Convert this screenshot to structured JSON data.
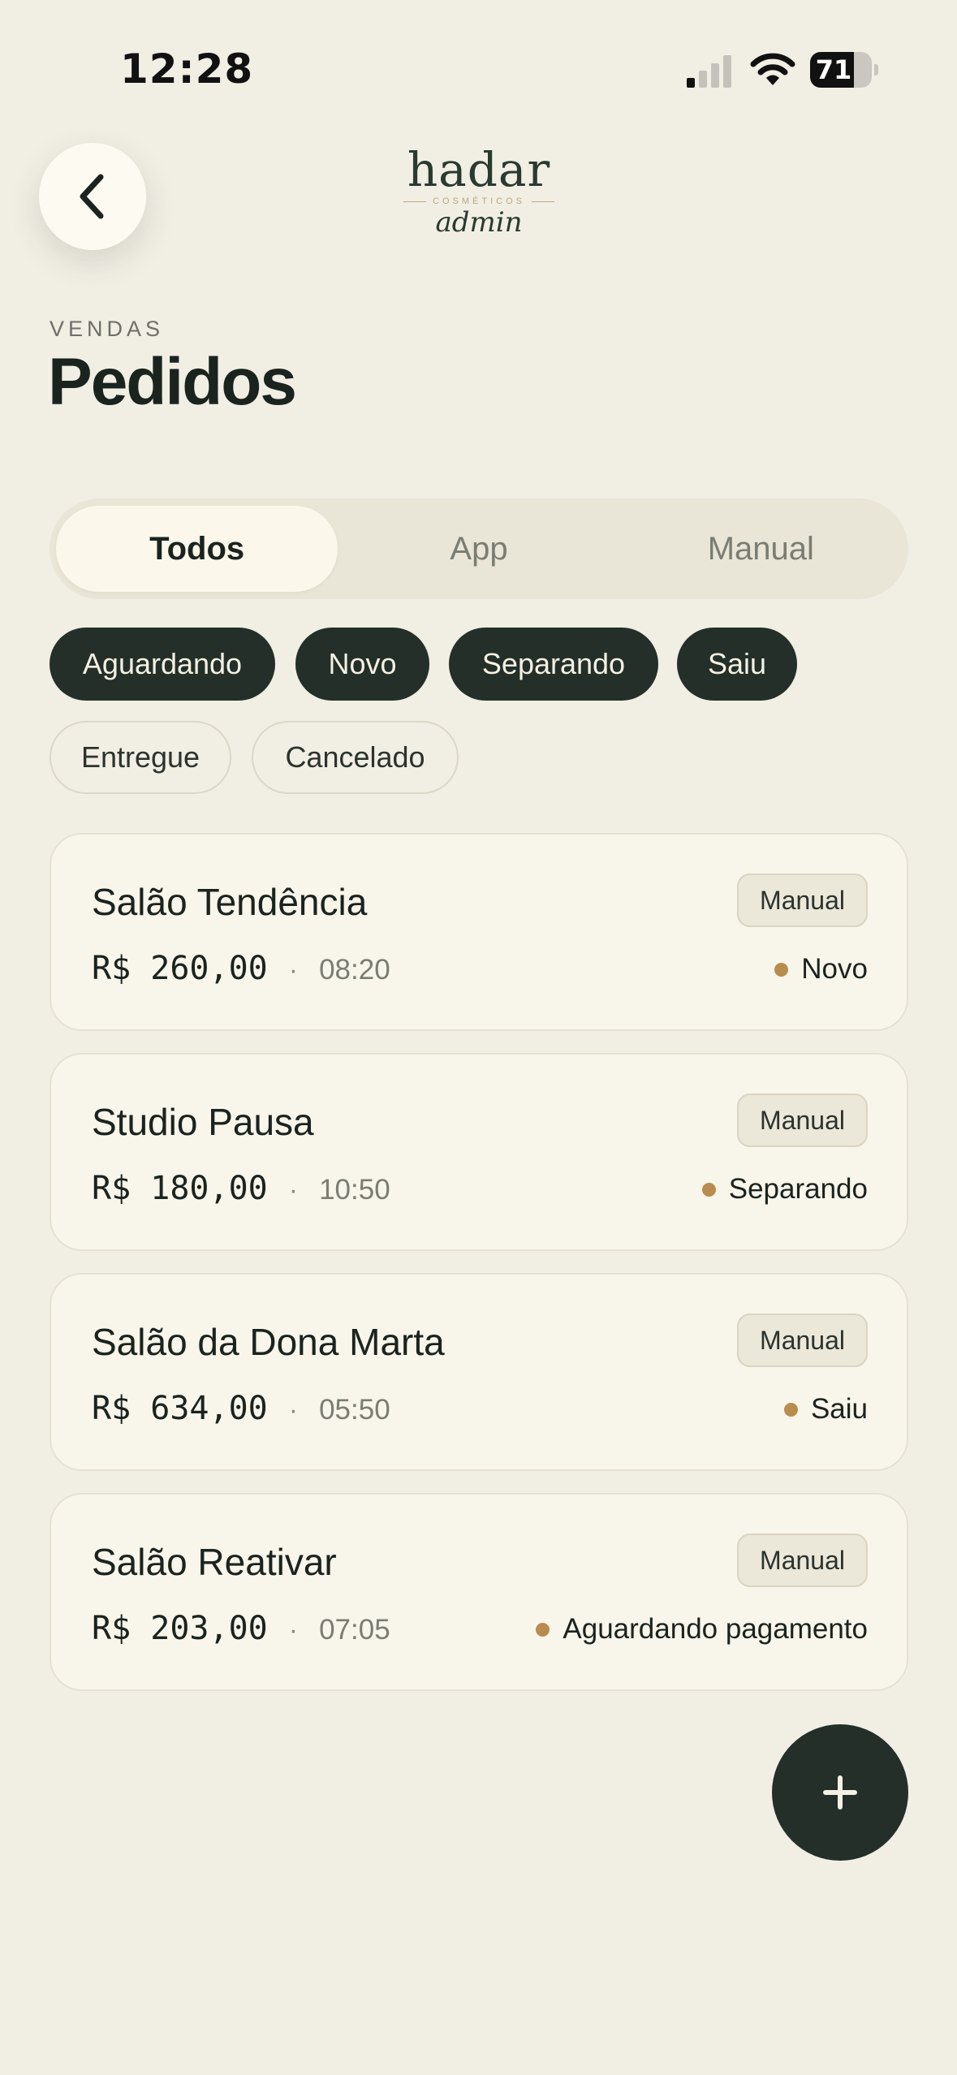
{
  "status_bar": {
    "time": "12:28",
    "battery_level": "71",
    "battery_fraction": 0.71,
    "signal_icon": "cellular-signal-icon",
    "wifi_icon": "wifi-icon"
  },
  "header": {
    "back_icon": "chevron-left-icon",
    "brand": {
      "name": "hadar",
      "tagline": "COSMÉTICOS",
      "subtitle": "admin"
    },
    "eyebrow": "VENDAS",
    "title": "Pedidos"
  },
  "tabs": [
    {
      "label": "Todos",
      "active": true
    },
    {
      "label": "App",
      "active": false
    },
    {
      "label": "Manual",
      "active": false
    }
  ],
  "chips": [
    {
      "label": "Aguardando",
      "selected": true
    },
    {
      "label": "Novo",
      "selected": true
    },
    {
      "label": "Separando",
      "selected": true
    },
    {
      "label": "Saiu",
      "selected": true
    },
    {
      "label": "Entregue",
      "selected": false
    },
    {
      "label": "Cancelado",
      "selected": false
    }
  ],
  "orders": [
    {
      "name": "Salão Tendência",
      "source": "Manual",
      "amount": "R$ 260,00",
      "separator": "·",
      "time": "08:20",
      "status": "Novo"
    },
    {
      "name": "Studio Pausa",
      "source": "Manual",
      "amount": "R$ 180,00",
      "separator": "·",
      "time": "10:50",
      "status": "Separando"
    },
    {
      "name": "Salão da Dona Marta",
      "source": "Manual",
      "amount": "R$ 634,00",
      "separator": "·",
      "time": "05:50",
      "status": "Saiu"
    },
    {
      "name": "Salão Reativar",
      "source": "Manual",
      "amount": "R$ 203,00",
      "separator": "·",
      "time": "07:05",
      "status": "Aguardando pagamento"
    }
  ],
  "fab": {
    "icon": "plus-icon"
  },
  "colors": {
    "background": "#f1eee4",
    "primary_dark": "#232f28",
    "card": "#f8f5ea",
    "status_dot": "#b88c4e"
  }
}
